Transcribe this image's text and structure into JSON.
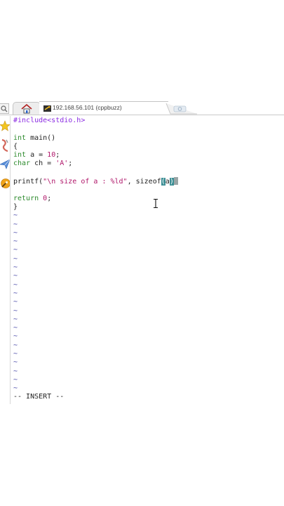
{
  "tabs": {
    "session_label": "192.168.56.101 (cppbuzz)"
  },
  "editor": {
    "lines": [
      {
        "segments": [
          {
            "t": "#include<stdio.h>",
            "c": "pp"
          }
        ]
      },
      {
        "segments": [
          {
            "t": "",
            "c": ""
          }
        ]
      },
      {
        "segments": [
          {
            "t": "int",
            "c": "kw"
          },
          {
            "t": " main()",
            "c": ""
          }
        ]
      },
      {
        "segments": [
          {
            "t": "{",
            "c": ""
          }
        ]
      },
      {
        "segments": [
          {
            "t": "int",
            "c": "kw"
          },
          {
            "t": " a = ",
            "c": ""
          },
          {
            "t": "10",
            "c": "num"
          },
          {
            "t": ";",
            "c": ""
          }
        ]
      },
      {
        "segments": [
          {
            "t": "char",
            "c": "kw"
          },
          {
            "t": " ch = ",
            "c": ""
          },
          {
            "t": "'A'",
            "c": "str"
          },
          {
            "t": ";",
            "c": ""
          }
        ]
      },
      {
        "segments": [
          {
            "t": "",
            "c": ""
          }
        ]
      },
      {
        "segments": [
          {
            "t": "printf(",
            "c": ""
          },
          {
            "t": "\"\\n size of a : %ld\"",
            "c": "str"
          },
          {
            "t": ", sizeof",
            "c": ""
          },
          {
            "t": "(",
            "c": "cursor-hl"
          },
          {
            "t": "a",
            "c": ""
          },
          {
            "t": ")",
            "c": "cursor-hl"
          },
          {
            "t": "",
            "c": "cursor-block"
          }
        ]
      },
      {
        "segments": [
          {
            "t": "",
            "c": ""
          }
        ]
      },
      {
        "segments": [
          {
            "t": "return",
            "c": "kw"
          },
          {
            "t": " ",
            "c": ""
          },
          {
            "t": "0",
            "c": "num"
          },
          {
            "t": ";",
            "c": ""
          }
        ]
      },
      {
        "segments": [
          {
            "t": "}",
            "c": ""
          }
        ]
      }
    ],
    "empty_line_marker": "~",
    "empty_line_count": 21,
    "mode_text": "-- INSERT --"
  },
  "colors": {
    "keyword": "#2e8b2e",
    "preprocessor": "#8a2be2",
    "string": "#b0176a",
    "match_highlight": "#3d8f95",
    "tilde": "#4a4aa8"
  },
  "icons": {
    "search_stub": "search-icon",
    "home_tab": "home-icon",
    "session_tab": "terminal-icon",
    "new_tab": "new-tab-icon",
    "sidebar": [
      "star-icon",
      "tools-icon",
      "send-icon",
      "settings-icon"
    ]
  }
}
